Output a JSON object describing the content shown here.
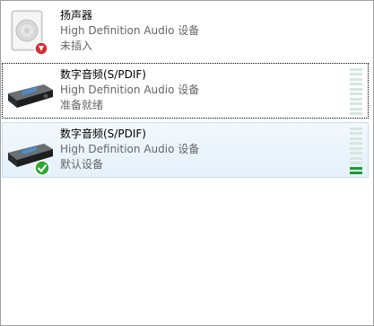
{
  "devices": [
    {
      "name": "扬声器",
      "driver": "High Definition Audio 设备",
      "status": "未插入",
      "icon": "speaker-icon",
      "badge": "unplugged-badge-icon",
      "meter_level": null
    },
    {
      "name": "数字音频(S/PDIF)",
      "driver": "High Definition Audio 设备",
      "status": "准备就绪",
      "icon": "digital-audio-receiver-icon",
      "badge": null,
      "meter_level": 0
    },
    {
      "name": "数字音频(S/PDIF)",
      "driver": "High Definition Audio 设备",
      "status": "默认设备",
      "icon": "digital-audio-receiver-icon",
      "badge": "default-device-check-icon",
      "meter_level": 0.15
    }
  ],
  "colors": {
    "status_text": "#666666",
    "meter_off": "#d6e6e0",
    "meter_on": "#1e9a32",
    "selected_bg": "#e4f0fb",
    "check_green": "#2ea82e",
    "unplugged_red": "#d03030"
  }
}
